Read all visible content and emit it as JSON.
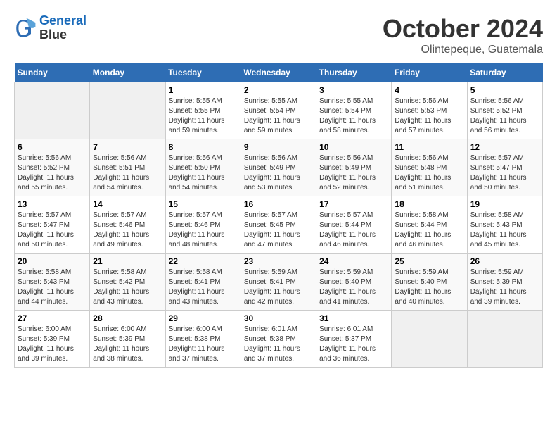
{
  "header": {
    "logo_line1": "General",
    "logo_line2": "Blue",
    "title": "October 2024",
    "subtitle": "Olintepeque, Guatemala"
  },
  "days_of_week": [
    "Sunday",
    "Monday",
    "Tuesday",
    "Wednesday",
    "Thursday",
    "Friday",
    "Saturday"
  ],
  "weeks": [
    [
      {
        "day": "",
        "sunrise": "",
        "sunset": "",
        "daylight": "",
        "empty": true
      },
      {
        "day": "",
        "sunrise": "",
        "sunset": "",
        "daylight": "",
        "empty": true
      },
      {
        "day": "1",
        "sunrise": "Sunrise: 5:55 AM",
        "sunset": "Sunset: 5:55 PM",
        "daylight": "Daylight: 11 hours and 59 minutes."
      },
      {
        "day": "2",
        "sunrise": "Sunrise: 5:55 AM",
        "sunset": "Sunset: 5:54 PM",
        "daylight": "Daylight: 11 hours and 59 minutes."
      },
      {
        "day": "3",
        "sunrise": "Sunrise: 5:55 AM",
        "sunset": "Sunset: 5:54 PM",
        "daylight": "Daylight: 11 hours and 58 minutes."
      },
      {
        "day": "4",
        "sunrise": "Sunrise: 5:56 AM",
        "sunset": "Sunset: 5:53 PM",
        "daylight": "Daylight: 11 hours and 57 minutes."
      },
      {
        "day": "5",
        "sunrise": "Sunrise: 5:56 AM",
        "sunset": "Sunset: 5:52 PM",
        "daylight": "Daylight: 11 hours and 56 minutes."
      }
    ],
    [
      {
        "day": "6",
        "sunrise": "Sunrise: 5:56 AM",
        "sunset": "Sunset: 5:52 PM",
        "daylight": "Daylight: 11 hours and 55 minutes."
      },
      {
        "day": "7",
        "sunrise": "Sunrise: 5:56 AM",
        "sunset": "Sunset: 5:51 PM",
        "daylight": "Daylight: 11 hours and 54 minutes."
      },
      {
        "day": "8",
        "sunrise": "Sunrise: 5:56 AM",
        "sunset": "Sunset: 5:50 PM",
        "daylight": "Daylight: 11 hours and 54 minutes."
      },
      {
        "day": "9",
        "sunrise": "Sunrise: 5:56 AM",
        "sunset": "Sunset: 5:49 PM",
        "daylight": "Daylight: 11 hours and 53 minutes."
      },
      {
        "day": "10",
        "sunrise": "Sunrise: 5:56 AM",
        "sunset": "Sunset: 5:49 PM",
        "daylight": "Daylight: 11 hours and 52 minutes."
      },
      {
        "day": "11",
        "sunrise": "Sunrise: 5:56 AM",
        "sunset": "Sunset: 5:48 PM",
        "daylight": "Daylight: 11 hours and 51 minutes."
      },
      {
        "day": "12",
        "sunrise": "Sunrise: 5:57 AM",
        "sunset": "Sunset: 5:47 PM",
        "daylight": "Daylight: 11 hours and 50 minutes."
      }
    ],
    [
      {
        "day": "13",
        "sunrise": "Sunrise: 5:57 AM",
        "sunset": "Sunset: 5:47 PM",
        "daylight": "Daylight: 11 hours and 50 minutes."
      },
      {
        "day": "14",
        "sunrise": "Sunrise: 5:57 AM",
        "sunset": "Sunset: 5:46 PM",
        "daylight": "Daylight: 11 hours and 49 minutes."
      },
      {
        "day": "15",
        "sunrise": "Sunrise: 5:57 AM",
        "sunset": "Sunset: 5:46 PM",
        "daylight": "Daylight: 11 hours and 48 minutes."
      },
      {
        "day": "16",
        "sunrise": "Sunrise: 5:57 AM",
        "sunset": "Sunset: 5:45 PM",
        "daylight": "Daylight: 11 hours and 47 minutes."
      },
      {
        "day": "17",
        "sunrise": "Sunrise: 5:57 AM",
        "sunset": "Sunset: 5:44 PM",
        "daylight": "Daylight: 11 hours and 46 minutes."
      },
      {
        "day": "18",
        "sunrise": "Sunrise: 5:58 AM",
        "sunset": "Sunset: 5:44 PM",
        "daylight": "Daylight: 11 hours and 46 minutes."
      },
      {
        "day": "19",
        "sunrise": "Sunrise: 5:58 AM",
        "sunset": "Sunset: 5:43 PM",
        "daylight": "Daylight: 11 hours and 45 minutes."
      }
    ],
    [
      {
        "day": "20",
        "sunrise": "Sunrise: 5:58 AM",
        "sunset": "Sunset: 5:43 PM",
        "daylight": "Daylight: 11 hours and 44 minutes."
      },
      {
        "day": "21",
        "sunrise": "Sunrise: 5:58 AM",
        "sunset": "Sunset: 5:42 PM",
        "daylight": "Daylight: 11 hours and 43 minutes."
      },
      {
        "day": "22",
        "sunrise": "Sunrise: 5:58 AM",
        "sunset": "Sunset: 5:41 PM",
        "daylight": "Daylight: 11 hours and 43 minutes."
      },
      {
        "day": "23",
        "sunrise": "Sunrise: 5:59 AM",
        "sunset": "Sunset: 5:41 PM",
        "daylight": "Daylight: 11 hours and 42 minutes."
      },
      {
        "day": "24",
        "sunrise": "Sunrise: 5:59 AM",
        "sunset": "Sunset: 5:40 PM",
        "daylight": "Daylight: 11 hours and 41 minutes."
      },
      {
        "day": "25",
        "sunrise": "Sunrise: 5:59 AM",
        "sunset": "Sunset: 5:40 PM",
        "daylight": "Daylight: 11 hours and 40 minutes."
      },
      {
        "day": "26",
        "sunrise": "Sunrise: 5:59 AM",
        "sunset": "Sunset: 5:39 PM",
        "daylight": "Daylight: 11 hours and 39 minutes."
      }
    ],
    [
      {
        "day": "27",
        "sunrise": "Sunrise: 6:00 AM",
        "sunset": "Sunset: 5:39 PM",
        "daylight": "Daylight: 11 hours and 39 minutes."
      },
      {
        "day": "28",
        "sunrise": "Sunrise: 6:00 AM",
        "sunset": "Sunset: 5:39 PM",
        "daylight": "Daylight: 11 hours and 38 minutes."
      },
      {
        "day": "29",
        "sunrise": "Sunrise: 6:00 AM",
        "sunset": "Sunset: 5:38 PM",
        "daylight": "Daylight: 11 hours and 37 minutes."
      },
      {
        "day": "30",
        "sunrise": "Sunrise: 6:01 AM",
        "sunset": "Sunset: 5:38 PM",
        "daylight": "Daylight: 11 hours and 37 minutes."
      },
      {
        "day": "31",
        "sunrise": "Sunrise: 6:01 AM",
        "sunset": "Sunset: 5:37 PM",
        "daylight": "Daylight: 11 hours and 36 minutes."
      },
      {
        "day": "",
        "sunrise": "",
        "sunset": "",
        "daylight": "",
        "empty": true
      },
      {
        "day": "",
        "sunrise": "",
        "sunset": "",
        "daylight": "",
        "empty": true
      }
    ]
  ]
}
